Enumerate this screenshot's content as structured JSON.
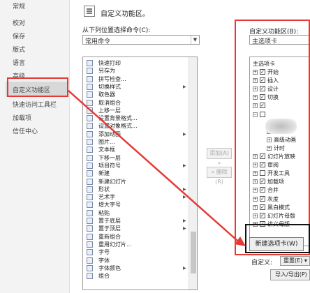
{
  "nav": {
    "items": [
      "常规",
      "校对",
      "保存",
      "版式",
      "语言",
      "高级",
      "自定义功能区",
      "快速访问工具栏",
      "加载项",
      "信任中心"
    ]
  },
  "header": {
    "title": "自定义功能区。"
  },
  "left_panel": {
    "label": "从下列位置选择命令(C):",
    "selected": "常用命令",
    "commands": [
      {
        "label": "快速打印",
        "sub": false
      },
      {
        "label": "另存为",
        "sub": false
      },
      {
        "label": "拼写检查...",
        "sub": false
      },
      {
        "label": "切换样式",
        "sub": true
      },
      {
        "label": "取色器",
        "sub": false
      },
      {
        "label": "取消组合",
        "sub": false
      },
      {
        "label": "上移一层",
        "sub": false
      },
      {
        "label": "设置背景格式...",
        "sub": false
      },
      {
        "label": "设置对象格式...",
        "sub": false
      },
      {
        "label": "添加动画",
        "sub": true
      },
      {
        "label": "图片...",
        "sub": false
      },
      {
        "label": "文本框",
        "sub": false
      },
      {
        "label": "下移一层",
        "sub": false
      },
      {
        "label": "项目符号",
        "sub": true
      },
      {
        "label": "新建",
        "sub": false
      },
      {
        "label": "新建幻灯片",
        "sub": false
      },
      {
        "label": "形状",
        "sub": true
      },
      {
        "label": "艺术字",
        "sub": true
      },
      {
        "label": "增大字号",
        "sub": false
      },
      {
        "label": "粘贴",
        "sub": false
      },
      {
        "label": "置于底层",
        "sub": true
      },
      {
        "label": "置于顶层",
        "sub": true
      },
      {
        "label": "重新组合",
        "sub": false
      },
      {
        "label": "重用幻灯片...",
        "sub": false
      },
      {
        "label": "字号",
        "sub": false
      },
      {
        "label": "字体",
        "sub": false
      },
      {
        "label": "字体颜色",
        "sub": true
      },
      {
        "label": "组合",
        "sub": false
      }
    ]
  },
  "middle": {
    "add": "添加(A) »",
    "remove": "« 删除(R)"
  },
  "right_panel": {
    "label": "自定义功能区(B):",
    "selected": "主选项卡",
    "tree_header": "主选项卡",
    "tree": [
      {
        "exp": "+",
        "chk": true,
        "label": "开始"
      },
      {
        "exp": "+",
        "chk": true,
        "label": "插入"
      },
      {
        "exp": "+",
        "chk": true,
        "label": "设计"
      },
      {
        "exp": "+",
        "chk": true,
        "label": "切换"
      },
      {
        "exp": "+",
        "chk": true,
        "label": ""
      },
      {
        "exp": "−",
        "chk": false,
        "label": ""
      },
      {
        "exp": "",
        "chk": false,
        "label": "预览",
        "indent": 2
      },
      {
        "exp": "+",
        "chk": false,
        "label": "动画",
        "indent": 2
      },
      {
        "exp": "+",
        "chk": false,
        "label": "高级动画",
        "indent": 2
      },
      {
        "exp": "+",
        "chk": false,
        "label": "计时",
        "indent": 2
      },
      {
        "exp": "+",
        "chk": true,
        "label": "幻灯片放映"
      },
      {
        "exp": "+",
        "chk": true,
        "label": "审阅"
      },
      {
        "exp": "+",
        "chk": false,
        "label": "开发工具"
      },
      {
        "exp": "+",
        "chk": true,
        "label": "加载项"
      },
      {
        "exp": "+",
        "chk": true,
        "label": "合并"
      },
      {
        "exp": "+",
        "chk": true,
        "label": "灰度"
      },
      {
        "exp": "+",
        "chk": true,
        "label": "黑白模式"
      },
      {
        "exp": "+",
        "chk": true,
        "label": "幻灯片母版"
      },
      {
        "exp": "+",
        "chk": true,
        "label": "讲义母版"
      }
    ],
    "new_tab": "新建选项卡(W)",
    "customize_label": "自定义:",
    "reset": "重置(E) ▾",
    "import": "导入/导出(P)"
  },
  "colors": {
    "annotation_red": "#e53935",
    "annotation_black": "#111111"
  }
}
